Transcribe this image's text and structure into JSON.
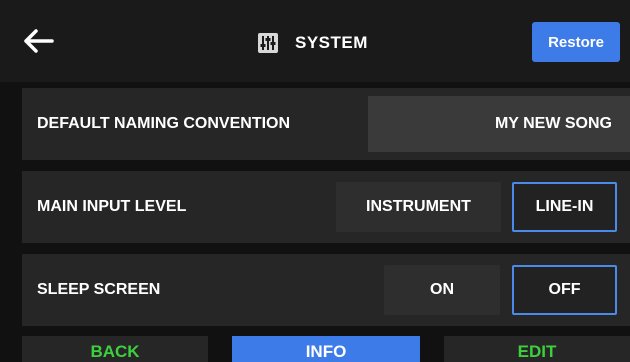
{
  "header": {
    "title": "SYSTEM",
    "back_icon": "arrow-left-icon",
    "title_icon": "sliders-icon",
    "restore_label": "Restore"
  },
  "settings": [
    {
      "label": "DEFAULT NAMING CONVENTION",
      "value": "MY NEW SONG"
    },
    {
      "label": "MAIN INPUT LEVEL",
      "options": [
        "INSTRUMENT",
        "LINE-IN"
      ],
      "selected": "LINE-IN"
    },
    {
      "label": "SLEEP SCREEN",
      "options": [
        "ON",
        "OFF"
      ],
      "selected": "OFF"
    }
  ],
  "footer": {
    "back_label": "BACK",
    "info_label": "INFO",
    "edit_label": "EDIT"
  },
  "colors": {
    "accent": "#3d7be8",
    "footer_text_green": "#3ecf3e",
    "selected_border": "#4a8ae8"
  }
}
